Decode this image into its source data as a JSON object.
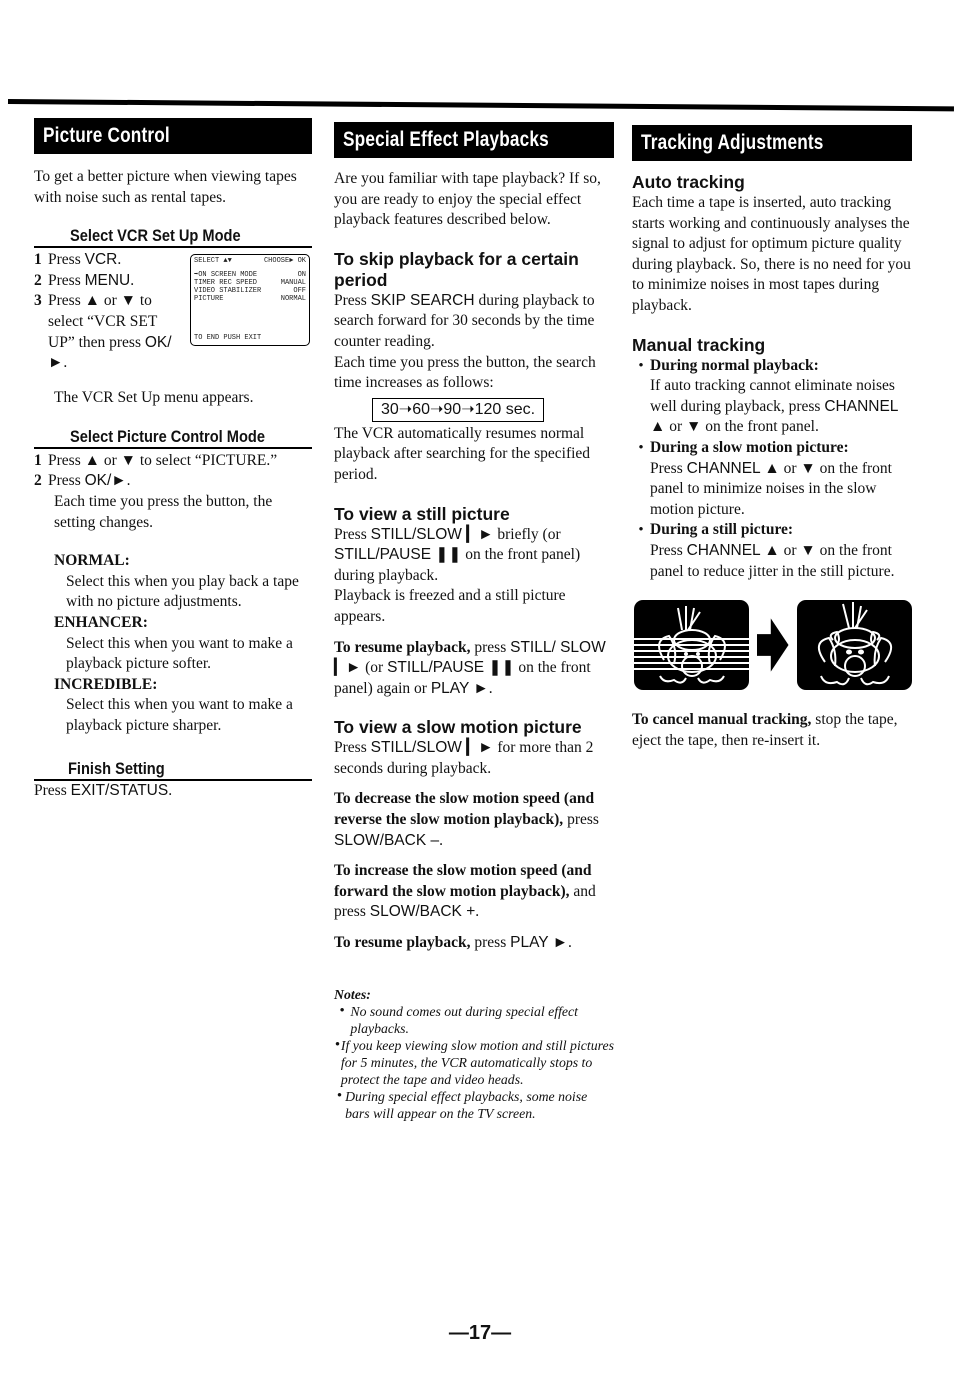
{
  "page": {
    "number": "—17—"
  },
  "picture_control": {
    "title": "Picture Control",
    "intro": "To get a better picture when viewing tapes with noise such as rental tapes.",
    "vcr_setup": {
      "heading": "Select VCR Set Up Mode",
      "steps": [
        {
          "n": "1",
          "pre": "Press ",
          "key": "VCR",
          "post": "."
        },
        {
          "n": "2",
          "pre": "Press ",
          "key": "MENU",
          "post": "."
        },
        {
          "n": "3",
          "pre": "Press ▲ or ▼ to select “VCR SET UP” then press ",
          "key": "OK/►",
          "post": "."
        }
      ],
      "result": "The VCR Set Up menu appears.",
      "osd": {
        "header_left": "SELECT ▲▼",
        "header_right": "CHOOSE► OK",
        "rows": [
          {
            "label": "➡ON SCREEN MODE",
            "value": "ON"
          },
          {
            "label": " TIMER REC SPEED",
            "value": "MANUAL"
          },
          {
            "label": " VIDEO STABILIZER",
            "value": "OFF"
          },
          {
            "label": " PICTURE",
            "value": "NORMAL"
          }
        ],
        "footer": "TO END PUSH EXIT"
      }
    },
    "picture_mode": {
      "heading": "Select Picture Control Mode",
      "steps": [
        {
          "n": "1",
          "pre": "Press ▲ or ▼ to select “PICTURE.”",
          "key": "",
          "post": ""
        },
        {
          "n": "2",
          "pre": "Press ",
          "key": "OK/►",
          "post": "."
        }
      ],
      "result": "Each time you press the button, the setting changes.",
      "modes": [
        {
          "name": "NORMAL:",
          "desc": "Select this when you play back a tape with no picture adjustments."
        },
        {
          "name": "ENHANCER:",
          "desc": "Select this when you want to make a playback picture softer."
        },
        {
          "name": "INCREDIBLE:",
          "desc": "Select this when you want to make a playback picture sharper."
        }
      ]
    },
    "finish": {
      "heading": "Finish Setting",
      "pre": "Press ",
      "key": "EXIT/STATUS",
      "post": "."
    }
  },
  "special_effect": {
    "title": "Special Effect Playbacks",
    "intro": "Are you familiar with tape playback? If so, you are ready to enjoy the special effect playback features described below.",
    "skip": {
      "heading": "To skip playback for a certain period",
      "p1_pre": "Press ",
      "p1_key": "SKIP SEARCH",
      "p1_post": " during playback to search forward for 30 seconds by the time counter reading.",
      "p2": "Each time you press the button, the search time increases as follows:",
      "sequence": "30➝60➝90➝120 sec.",
      "p3": "The VCR automatically resumes normal playback after searching for the specified period."
    },
    "still": {
      "heading": "To view a still picture",
      "p1_pre": "Press ",
      "p1_key": "STILL/SLOW ▎►",
      "p1_mid": " briefly (or ",
      "p1_key2": "STILL/PAUSE ❚❚",
      "p1_post": " on the front panel) during playback.",
      "p2": "Playback is freezed and a still picture appears.",
      "resume_bold": "To resume playback,",
      "resume_pre": " press ",
      "resume_key": "STILL/ SLOW ▎►",
      "resume_mid": " (or ",
      "resume_key2": "STILL/PAUSE ❚❚",
      "resume_mid2": " on the front panel) again or ",
      "resume_key3": "PLAY ►",
      "resume_post": "."
    },
    "slow": {
      "heading": "To view a slow motion picture",
      "p1_pre": "Press ",
      "p1_key": "STILL/SLOW ▎►",
      "p1_post": " for more than 2 seconds during playback.",
      "decrease_bold": "To decrease the slow motion speed (and reverse the slow motion playback),",
      "decrease_pre": " press ",
      "decrease_key": "SLOW/BACK –",
      "decrease_post": ".",
      "increase_bold": "To increase the slow motion speed (and forward the slow motion playback),",
      "increase_pre": " and press ",
      "increase_key": "SLOW/BACK +",
      "increase_post": ".",
      "resume_bold": "To resume playback,",
      "resume_pre": " press ",
      "resume_key": "PLAY ►",
      "resume_post": "."
    },
    "notes": {
      "heading": "Notes:",
      "items": [
        "No sound comes out during special effect playbacks.",
        "If you keep viewing slow motion and still pictures for 5 minutes, the VCR automatically stops to protect the tape and video heads.",
        "During special effect playbacks, some noise bars will appear on the TV screen."
      ]
    }
  },
  "tracking": {
    "title": "Tracking Adjustments",
    "auto": {
      "heading": "Auto tracking",
      "text": "Each time a tape is inserted, auto tracking starts working and continuously analyses the signal to adjust for optimum picture quality during playback. So, there is no need for you to minimize noises in most tapes during playback."
    },
    "manual": {
      "heading": "Manual tracking",
      "items": [
        {
          "label": "During normal playback:",
          "pre": "If auto tracking cannot eliminate noises well during playback, press ",
          "key": "CHANNEL ▲",
          "mid": " or ▼ on the front panel.",
          "post": ""
        },
        {
          "label": "During a slow motion picture:",
          "pre": "Press ",
          "key": "CHANNEL ▲",
          "mid": " or ▼ on the front panel to minimize noises in the slow motion picture.",
          "post": ""
        },
        {
          "label": "During a still picture:",
          "pre": "Press ",
          "key": "CHANNEL ▲",
          "mid": " or ▼ on the front panel to reduce jitter in the still picture.",
          "post": ""
        }
      ]
    },
    "illustration": {
      "before": "noisy-picture",
      "after": "clear-picture"
    },
    "cancel_bold": "To cancel manual tracking,",
    "cancel_text": " stop the tape, eject the tape, then re-insert it."
  }
}
